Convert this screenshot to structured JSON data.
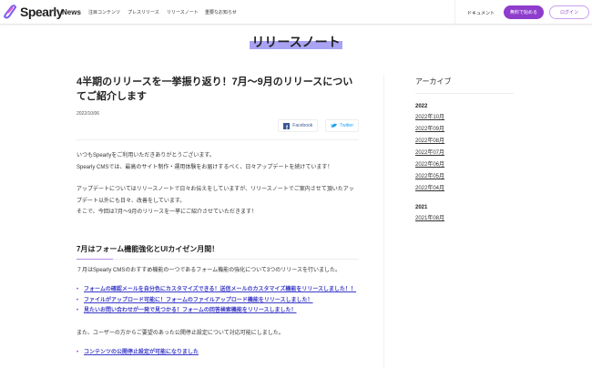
{
  "header": {
    "logo": "Spearly",
    "news": "News",
    "nav": [
      "注目コンテンツ",
      "プレスリリース",
      "リリースノート",
      "重要なお知らせ"
    ],
    "docs": "ドキュメント",
    "start": "無料で始める",
    "login": "ログイン",
    "accent": "#8e3ccc"
  },
  "page_title": "リリースノート",
  "article": {
    "title": "4半期のリリースを一挙振り返り！7月〜9月のリリースについてご紹介します",
    "date": "2022/10/06",
    "facebook": "Facebook",
    "twitter": "Twitter",
    "p1": "いつもSpearlyをご利用いただきありがとうございます。",
    "p2": "Spearly CMSでは、最高のサイト制作・運用体験をお届けするべく、日々アップデートを続けています！",
    "p3": "アップデートについてはリリースノートで日々お伝えをしていますが、リリースノートでご案内させて頂いたアップデート以外にも日々、改善をしています。",
    "p4": "そこで、今回は7月〜9月のリリースを一挙にご紹介させていただきます！",
    "h2": "7月はフォーム機能強化とUIカイゼン月間！",
    "p5": "７月はSpearly CMSのおすすめ機能の一つであるフォーム機能の強化について3つのリリースを行いました。",
    "links": [
      "フォームの確認メールを自分色にカスタマイズできる！送信メールのカスタマイズ機能をリリースしました！！",
      "ファイルがアップロード可能に！フォームのファイルアップロード機能をリリースしました！",
      "見たいお問い合わせが一発で見つかる！フォームの回答検索機能をリリースしました！"
    ],
    "p6": "また、ユーザーの方からご要望のあった公開停止設定について対応可能にしました。",
    "link2": "コンテンツの公開停止設定が可能になりました"
  },
  "sidebar": {
    "title": "アーカイブ",
    "y2022": "2022",
    "months2022": [
      "2022年10月",
      "2022年09月",
      "2022年08月",
      "2022年07月",
      "2022年06月",
      "2022年05月",
      "2022年04月"
    ],
    "y2021": "2021",
    "months2021": [
      "2021年08月"
    ]
  }
}
